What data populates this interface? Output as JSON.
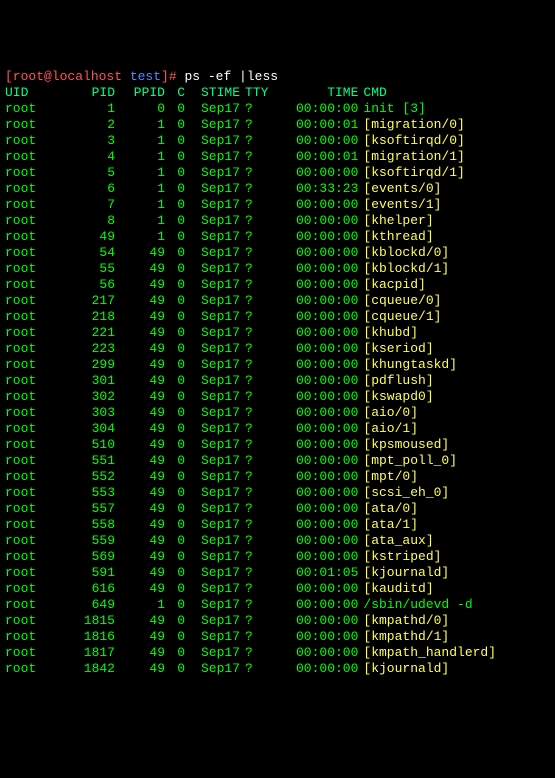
{
  "prompt": {
    "user_host": "[root@localhost ",
    "dir": "test",
    "close": "]# ",
    "command": "ps -ef |less"
  },
  "headers": {
    "uid": "UID",
    "pid": "PID",
    "ppid": "PPID",
    "c": "C",
    "stime": "STIME",
    "tty": "TTY",
    "time": "TIME",
    "cmd": "CMD"
  },
  "rows": [
    {
      "uid": "root",
      "pid": "1",
      "ppid": "0",
      "c": "0",
      "stime": "Sep17",
      "tty": "?",
      "time": "00:00:00",
      "cmd": "init [3]",
      "cmdClass": "cmd-green"
    },
    {
      "uid": "root",
      "pid": "2",
      "ppid": "1",
      "c": "0",
      "stime": "Sep17",
      "tty": "?",
      "time": "00:00:01",
      "cmd": "[migration/0]",
      "cmdClass": "cmd-yellow"
    },
    {
      "uid": "root",
      "pid": "3",
      "ppid": "1",
      "c": "0",
      "stime": "Sep17",
      "tty": "?",
      "time": "00:00:00",
      "cmd": "[ksoftirqd/0]",
      "cmdClass": "cmd-yellow"
    },
    {
      "uid": "root",
      "pid": "4",
      "ppid": "1",
      "c": "0",
      "stime": "Sep17",
      "tty": "?",
      "time": "00:00:01",
      "cmd": "[migration/1]",
      "cmdClass": "cmd-yellow"
    },
    {
      "uid": "root",
      "pid": "5",
      "ppid": "1",
      "c": "0",
      "stime": "Sep17",
      "tty": "?",
      "time": "00:00:00",
      "cmd": "[ksoftirqd/1]",
      "cmdClass": "cmd-yellow"
    },
    {
      "uid": "root",
      "pid": "6",
      "ppid": "1",
      "c": "0",
      "stime": "Sep17",
      "tty": "?",
      "time": "00:33:23",
      "cmd": "[events/0]",
      "cmdClass": "cmd-yellow"
    },
    {
      "uid": "root",
      "pid": "7",
      "ppid": "1",
      "c": "0",
      "stime": "Sep17",
      "tty": "?",
      "time": "00:00:00",
      "cmd": "[events/1]",
      "cmdClass": "cmd-yellow"
    },
    {
      "uid": "root",
      "pid": "8",
      "ppid": "1",
      "c": "0",
      "stime": "Sep17",
      "tty": "?",
      "time": "00:00:00",
      "cmd": "[khelper]",
      "cmdClass": "cmd-yellow"
    },
    {
      "uid": "root",
      "pid": "49",
      "ppid": "1",
      "c": "0",
      "stime": "Sep17",
      "tty": "?",
      "time": "00:00:00",
      "cmd": "[kthread]",
      "cmdClass": "cmd-yellow"
    },
    {
      "uid": "root",
      "pid": "54",
      "ppid": "49",
      "c": "0",
      "stime": "Sep17",
      "tty": "?",
      "time": "00:00:00",
      "cmd": "[kblockd/0]",
      "cmdClass": "cmd-yellow"
    },
    {
      "uid": "root",
      "pid": "55",
      "ppid": "49",
      "c": "0",
      "stime": "Sep17",
      "tty": "?",
      "time": "00:00:00",
      "cmd": "[kblockd/1]",
      "cmdClass": "cmd-yellow"
    },
    {
      "uid": "root",
      "pid": "56",
      "ppid": "49",
      "c": "0",
      "stime": "Sep17",
      "tty": "?",
      "time": "00:00:00",
      "cmd": "[kacpid]",
      "cmdClass": "cmd-yellow"
    },
    {
      "uid": "root",
      "pid": "217",
      "ppid": "49",
      "c": "0",
      "stime": "Sep17",
      "tty": "?",
      "time": "00:00:00",
      "cmd": "[cqueue/0]",
      "cmdClass": "cmd-yellow"
    },
    {
      "uid": "root",
      "pid": "218",
      "ppid": "49",
      "c": "0",
      "stime": "Sep17",
      "tty": "?",
      "time": "00:00:00",
      "cmd": "[cqueue/1]",
      "cmdClass": "cmd-yellow"
    },
    {
      "uid": "root",
      "pid": "221",
      "ppid": "49",
      "c": "0",
      "stime": "Sep17",
      "tty": "?",
      "time": "00:00:00",
      "cmd": "[khubd]",
      "cmdClass": "cmd-yellow"
    },
    {
      "uid": "root",
      "pid": "223",
      "ppid": "49",
      "c": "0",
      "stime": "Sep17",
      "tty": "?",
      "time": "00:00:00",
      "cmd": "[kseriod]",
      "cmdClass": "cmd-yellow"
    },
    {
      "uid": "root",
      "pid": "299",
      "ppid": "49",
      "c": "0",
      "stime": "Sep17",
      "tty": "?",
      "time": "00:00:00",
      "cmd": "[khungtaskd]",
      "cmdClass": "cmd-yellow"
    },
    {
      "uid": "root",
      "pid": "301",
      "ppid": "49",
      "c": "0",
      "stime": "Sep17",
      "tty": "?",
      "time": "00:00:00",
      "cmd": "[pdflush]",
      "cmdClass": "cmd-yellow"
    },
    {
      "uid": "root",
      "pid": "302",
      "ppid": "49",
      "c": "0",
      "stime": "Sep17",
      "tty": "?",
      "time": "00:00:00",
      "cmd": "[kswapd0]",
      "cmdClass": "cmd-yellow"
    },
    {
      "uid": "root",
      "pid": "303",
      "ppid": "49",
      "c": "0",
      "stime": "Sep17",
      "tty": "?",
      "time": "00:00:00",
      "cmd": "[aio/0]",
      "cmdClass": "cmd-yellow"
    },
    {
      "uid": "root",
      "pid": "304",
      "ppid": "49",
      "c": "0",
      "stime": "Sep17",
      "tty": "?",
      "time": "00:00:00",
      "cmd": "[aio/1]",
      "cmdClass": "cmd-yellow"
    },
    {
      "uid": "root",
      "pid": "510",
      "ppid": "49",
      "c": "0",
      "stime": "Sep17",
      "tty": "?",
      "time": "00:00:00",
      "cmd": "[kpsmoused]",
      "cmdClass": "cmd-yellow"
    },
    {
      "uid": "root",
      "pid": "551",
      "ppid": "49",
      "c": "0",
      "stime": "Sep17",
      "tty": "?",
      "time": "00:00:00",
      "cmd": "[mpt_poll_0]",
      "cmdClass": "cmd-yellow"
    },
    {
      "uid": "root",
      "pid": "552",
      "ppid": "49",
      "c": "0",
      "stime": "Sep17",
      "tty": "?",
      "time": "00:00:00",
      "cmd": "[mpt/0]",
      "cmdClass": "cmd-yellow"
    },
    {
      "uid": "root",
      "pid": "553",
      "ppid": "49",
      "c": "0",
      "stime": "Sep17",
      "tty": "?",
      "time": "00:00:00",
      "cmd": "[scsi_eh_0]",
      "cmdClass": "cmd-yellow"
    },
    {
      "uid": "root",
      "pid": "557",
      "ppid": "49",
      "c": "0",
      "stime": "Sep17",
      "tty": "?",
      "time": "00:00:00",
      "cmd": "[ata/0]",
      "cmdClass": "cmd-yellow"
    },
    {
      "uid": "root",
      "pid": "558",
      "ppid": "49",
      "c": "0",
      "stime": "Sep17",
      "tty": "?",
      "time": "00:00:00",
      "cmd": "[ata/1]",
      "cmdClass": "cmd-yellow"
    },
    {
      "uid": "root",
      "pid": "559",
      "ppid": "49",
      "c": "0",
      "stime": "Sep17",
      "tty": "?",
      "time": "00:00:00",
      "cmd": "[ata_aux]",
      "cmdClass": "cmd-yellow"
    },
    {
      "uid": "root",
      "pid": "569",
      "ppid": "49",
      "c": "0",
      "stime": "Sep17",
      "tty": "?",
      "time": "00:00:00",
      "cmd": "[kstriped]",
      "cmdClass": "cmd-yellow"
    },
    {
      "uid": "root",
      "pid": "591",
      "ppid": "49",
      "c": "0",
      "stime": "Sep17",
      "tty": "?",
      "time": "00:01:05",
      "cmd": "[kjournald]",
      "cmdClass": "cmd-yellow"
    },
    {
      "uid": "root",
      "pid": "616",
      "ppid": "49",
      "c": "0",
      "stime": "Sep17",
      "tty": "?",
      "time": "00:00:00",
      "cmd": "[kauditd]",
      "cmdClass": "cmd-yellow"
    },
    {
      "uid": "root",
      "pid": "649",
      "ppid": "1",
      "c": "0",
      "stime": "Sep17",
      "tty": "?",
      "time": "00:00:00",
      "cmd": "/sbin/udevd -d",
      "cmdClass": "cmd-green"
    },
    {
      "uid": "root",
      "pid": "1815",
      "ppid": "49",
      "c": "0",
      "stime": "Sep17",
      "tty": "?",
      "time": "00:00:00",
      "cmd": "[kmpathd/0]",
      "cmdClass": "cmd-yellow"
    },
    {
      "uid": "root",
      "pid": "1816",
      "ppid": "49",
      "c": "0",
      "stime": "Sep17",
      "tty": "?",
      "time": "00:00:00",
      "cmd": "[kmpathd/1]",
      "cmdClass": "cmd-yellow"
    },
    {
      "uid": "root",
      "pid": "1817",
      "ppid": "49",
      "c": "0",
      "stime": "Sep17",
      "tty": "?",
      "time": "00:00:00",
      "cmd": "[kmpath_handlerd]",
      "cmdClass": "cmd-yellow"
    },
    {
      "uid": "root",
      "pid": "1842",
      "ppid": "49",
      "c": "0",
      "stime": "Sep17",
      "tty": "?",
      "time": "00:00:00",
      "cmd": "[kjournald]",
      "cmdClass": "cmd-yellow"
    }
  ]
}
